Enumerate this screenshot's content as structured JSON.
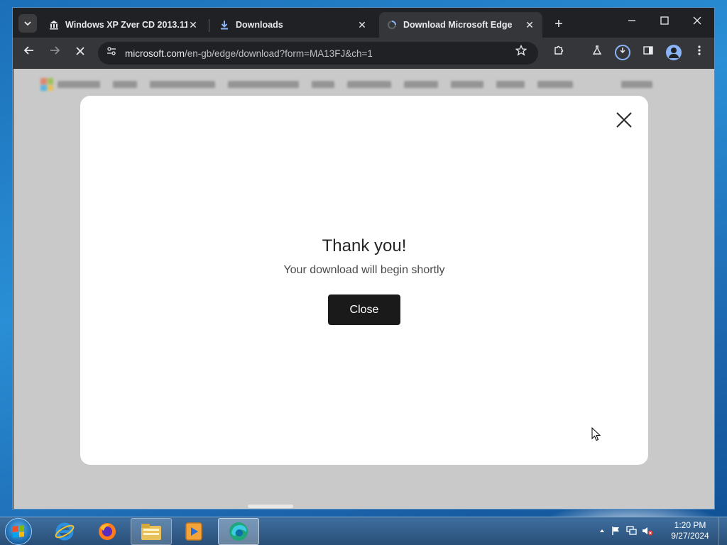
{
  "browser": {
    "tabs": [
      {
        "title": "Windows XP Zver CD 2013.11 :",
        "icon": "bank-icon",
        "active": false
      },
      {
        "title": "Downloads",
        "icon": "download-icon",
        "active": false
      },
      {
        "title": "Download Microsoft Edge",
        "icon": "loading-icon",
        "active": true
      }
    ],
    "address": {
      "host": "microsoft.com",
      "path": "/en-gb/edge/download?form=MA13FJ&ch=1"
    }
  },
  "dialog": {
    "heading": "Thank you!",
    "message": "Your download will begin shortly",
    "button_label": "Close"
  },
  "taskbar": {
    "apps": [
      "internet-explorer",
      "firefox",
      "file-explorer",
      "media-player",
      "edge-installer"
    ],
    "clock_time": "1:20 PM",
    "clock_date": "9/27/2024"
  },
  "colors": {
    "dialog_button": "#1a1a1a",
    "browser_dark": "#202124",
    "overlay": "#c9c9c9"
  }
}
